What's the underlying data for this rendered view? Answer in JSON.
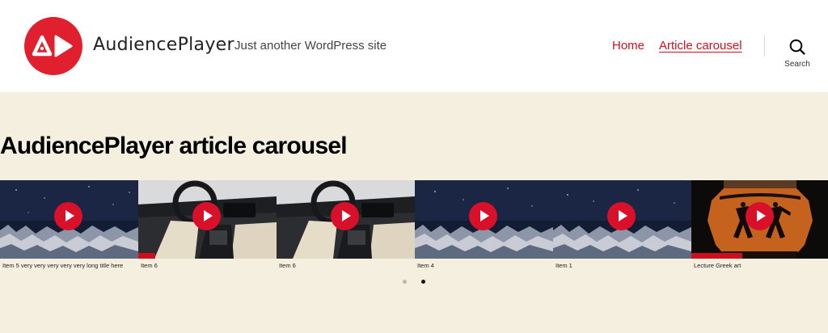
{
  "site": {
    "title": "AudiencePlayer",
    "tagline": "Just another WordPress site",
    "brand_color": "#e0202e"
  },
  "nav": {
    "items": [
      {
        "label": "Home",
        "active": false
      },
      {
        "label": "Article carousel",
        "active": true
      }
    ],
    "link_color": "#d0101f",
    "search_label": "Search",
    "search_icon": "search-icon"
  },
  "page": {
    "title": "AudiencePlayer article carousel"
  },
  "carousel": {
    "accent_color": "#cc0f1f",
    "slides": [
      {
        "caption": "Item 5 very very very very very long title here",
        "thumbnail": "night-sky-forest",
        "progress": 0
      },
      {
        "caption": "Item 6",
        "thumbnail": "car-interior",
        "progress": 0.12
      },
      {
        "caption": "Item 6",
        "thumbnail": "car-interior",
        "progress": 0
      },
      {
        "caption": "Item 4",
        "thumbnail": "night-sky-forest",
        "progress": 0
      },
      {
        "caption": "Item 1",
        "thumbnail": "night-sky-forest",
        "progress": 0
      },
      {
        "caption": "Lecture Greek art",
        "thumbnail": "greek-vase",
        "progress": 0.37
      }
    ],
    "pagination": {
      "pages": 2,
      "active": 2
    }
  }
}
